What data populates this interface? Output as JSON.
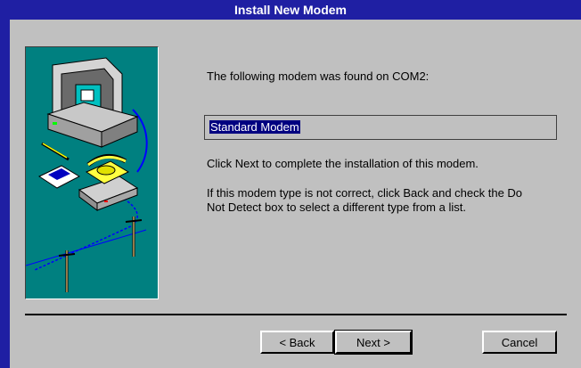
{
  "window": {
    "title": "Install New Modem"
  },
  "content": {
    "found_text": "The following modem was found on COM2:",
    "modem_name": "Standard Modem",
    "next_instruction": "Click Next to complete the installation of this modem.",
    "wrong_type_line1": "If this modem type is not correct, click Back and check the Do",
    "wrong_type_line2": "Not Detect box to select a different type from a list."
  },
  "buttons": {
    "back": "< Back",
    "next": "Next >",
    "cancel": "Cancel"
  },
  "colors": {
    "title_bar": "#1f1fa3",
    "illustration_bg": "#008080",
    "dialog_bg": "#c0c0c0",
    "selection": "#000080"
  },
  "illustration": {
    "icons": [
      "computer-icon",
      "monitor-icon",
      "telephone-icon",
      "modem-icon",
      "notepad-icon",
      "pencil-icon",
      "telephone-pole-icon"
    ]
  }
}
